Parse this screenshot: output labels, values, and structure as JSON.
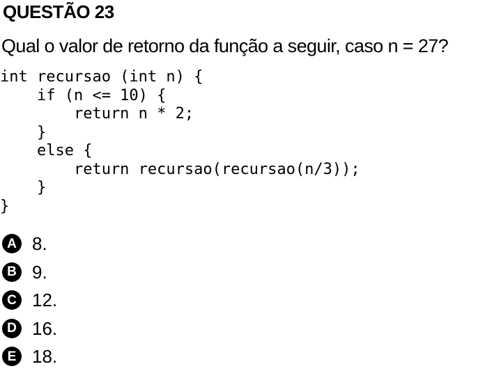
{
  "question": {
    "title": "QUESTÃO 23",
    "prompt": "Qual o valor de retorno da função a seguir, caso n = 27?"
  },
  "code": {
    "lines": [
      "int recursao (int n) {",
      "    if (n <= 10) {",
      "        return n * 2;",
      "    }",
      "    else {",
      "        return recursao(recursao(n/3));",
      "    }",
      "}"
    ]
  },
  "options": [
    {
      "letter": "A",
      "text": "8."
    },
    {
      "letter": "B",
      "text": "9."
    },
    {
      "letter": "C",
      "text": "12."
    },
    {
      "letter": "D",
      "text": "16."
    },
    {
      "letter": "E",
      "text": "18."
    }
  ]
}
